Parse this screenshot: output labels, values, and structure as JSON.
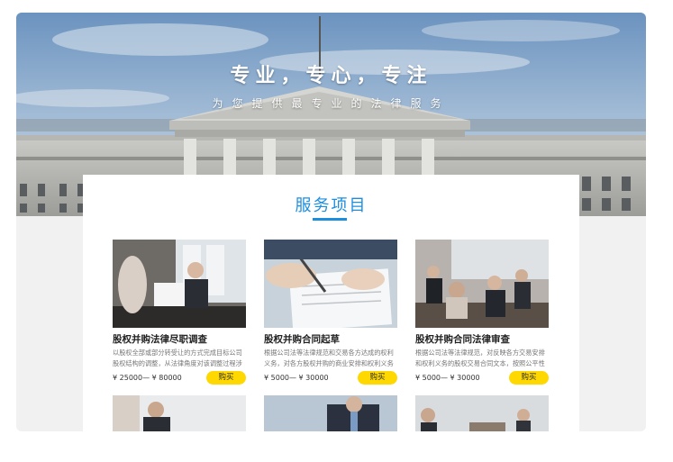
{
  "hero": {
    "title": "专业，专心，专注",
    "subtitle": "为您提供最专业的法律服务"
  },
  "section": {
    "title": "服务项目"
  },
  "services": [
    {
      "name": "股权并购法律尽职调查",
      "desc": "以股权全部或部分转受让的方式完成目标公司股权结构的调整，从法律角度对该调整过程涉[...]",
      "price": "¥ 25000— ¥ 80000",
      "buy_label": "购买"
    },
    {
      "name": "股权并购合同起草",
      "desc": "根据公司法等法律规范和交易各方达成的权利义务，对各方股权并购的商业安排和权利义务[...]",
      "price": "¥ 5000— ¥ 30000",
      "buy_label": "购买"
    },
    {
      "name": "股权并购合同法律审查",
      "desc": "根据公司法等法律规范，对反映各方交易安排和权利义务的股权交易合同文本，按照公平性[...]",
      "price": "¥ 5000— ¥ 30000",
      "buy_label": "购买"
    }
  ],
  "colors": {
    "accent": "#1d8ede",
    "buy_button": "#ffd800"
  }
}
